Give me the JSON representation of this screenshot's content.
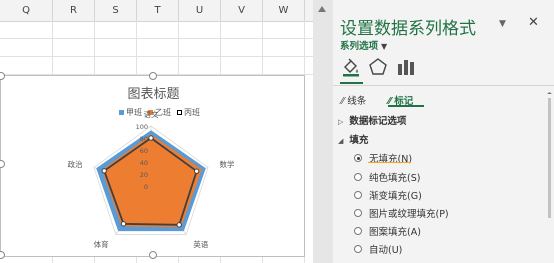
{
  "sheet": {
    "columns": [
      "Q",
      "R",
      "S",
      "T",
      "U",
      "V",
      "W"
    ]
  },
  "chart": {
    "title": "图表标题",
    "legend": [
      {
        "name": "甲班",
        "color": "#5b9bd5"
      },
      {
        "name": "乙班",
        "color": "#ed7d31"
      },
      {
        "name": "丙班",
        "color": "#000000"
      }
    ]
  },
  "chart_data": {
    "type": "radar",
    "categories": [
      "语文",
      "数学",
      "英语",
      "体育",
      "政治"
    ],
    "ylim": [
      0,
      100
    ],
    "ticks": [
      "100",
      "80",
      "60",
      "40",
      "20",
      "0"
    ],
    "series": [
      {
        "name": "甲班",
        "values": [
          92,
          95,
          92,
          92,
          95
        ],
        "color": "#5b9bd5"
      },
      {
        "name": "乙班",
        "values": [
          85,
          88,
          84,
          82,
          85
        ],
        "color": "#ed7d31"
      },
      {
        "name": "丙班",
        "values": [
          80,
          80,
          80,
          78,
          82
        ],
        "color": "#404040"
      }
    ]
  },
  "pane": {
    "title": "设置数据系列格式",
    "dropdown_icon": "chevron-down-icon",
    "close_icon": "close-icon",
    "series_options": "系列选项",
    "subtabs": {
      "line": "线条",
      "marker": "标记"
    },
    "marker_options": "数据标记选项",
    "fill": "填充",
    "fill_options": [
      {
        "label": "无填充(N)",
        "selected": true
      },
      {
        "label": "纯色填充(S)",
        "selected": false
      },
      {
        "label": "渐变填充(G)",
        "selected": false
      },
      {
        "label": "图片或纹理填充(P)",
        "selected": false
      },
      {
        "label": "图案填充(A)",
        "selected": false
      },
      {
        "label": "自动(U)",
        "selected": false
      }
    ],
    "accent_color": "#217346"
  }
}
